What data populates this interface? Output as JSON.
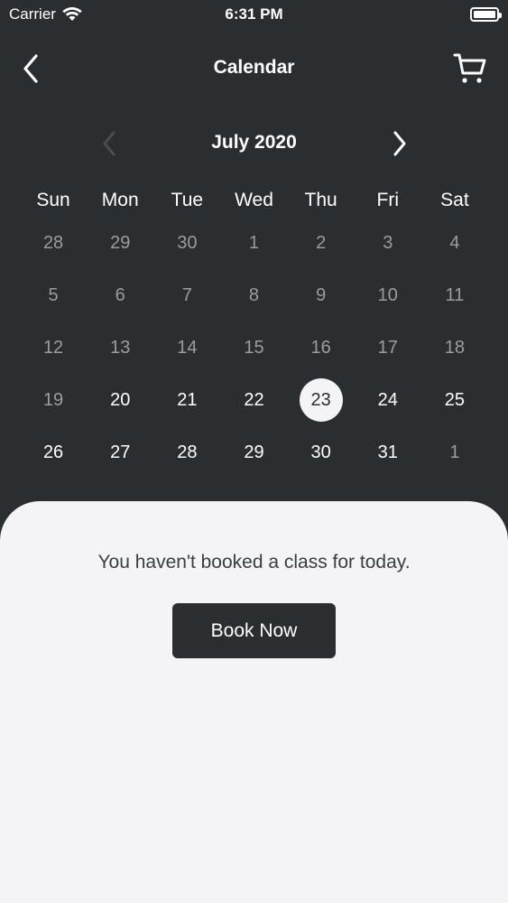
{
  "status_bar": {
    "carrier": "Carrier",
    "time": "6:31 PM",
    "battery_level": 1.0
  },
  "nav": {
    "title": "Calendar",
    "back_icon": "chevron-left-icon",
    "cart_icon": "cart-icon"
  },
  "calendar": {
    "month_label": "July 2020",
    "weekdays": [
      "Sun",
      "Mon",
      "Tue",
      "Wed",
      "Thu",
      "Fri",
      "Sat"
    ],
    "selected_day": "23",
    "days": [
      {
        "label": "28",
        "state": "muted"
      },
      {
        "label": "29",
        "state": "muted"
      },
      {
        "label": "30",
        "state": "muted"
      },
      {
        "label": "1",
        "state": "muted"
      },
      {
        "label": "2",
        "state": "muted"
      },
      {
        "label": "3",
        "state": "muted"
      },
      {
        "label": "4",
        "state": "muted"
      },
      {
        "label": "5",
        "state": "muted"
      },
      {
        "label": "6",
        "state": "muted"
      },
      {
        "label": "7",
        "state": "muted"
      },
      {
        "label": "8",
        "state": "muted"
      },
      {
        "label": "9",
        "state": "muted"
      },
      {
        "label": "10",
        "state": "muted"
      },
      {
        "label": "11",
        "state": "muted"
      },
      {
        "label": "12",
        "state": "muted"
      },
      {
        "label": "13",
        "state": "muted"
      },
      {
        "label": "14",
        "state": "muted"
      },
      {
        "label": "15",
        "state": "muted"
      },
      {
        "label": "16",
        "state": "muted"
      },
      {
        "label": "17",
        "state": "muted"
      },
      {
        "label": "18",
        "state": "muted"
      },
      {
        "label": "19",
        "state": "muted"
      },
      {
        "label": "20",
        "state": "active"
      },
      {
        "label": "21",
        "state": "active"
      },
      {
        "label": "22",
        "state": "active"
      },
      {
        "label": "23",
        "state": "selected"
      },
      {
        "label": "24",
        "state": "active"
      },
      {
        "label": "25",
        "state": "active"
      },
      {
        "label": "26",
        "state": "active"
      },
      {
        "label": "27",
        "state": "active"
      },
      {
        "label": "28",
        "state": "active"
      },
      {
        "label": "29",
        "state": "active"
      },
      {
        "label": "30",
        "state": "active"
      },
      {
        "label": "31",
        "state": "active"
      },
      {
        "label": "1",
        "state": "muted"
      }
    ]
  },
  "booking": {
    "empty_message": "You haven't booked a class for today.",
    "book_button_label": "Book Now"
  },
  "colors": {
    "background": "#2b2e30",
    "sheet": "#f4f4f6",
    "muted_day": "#9a9d9f",
    "active_day": "#ffffff"
  }
}
